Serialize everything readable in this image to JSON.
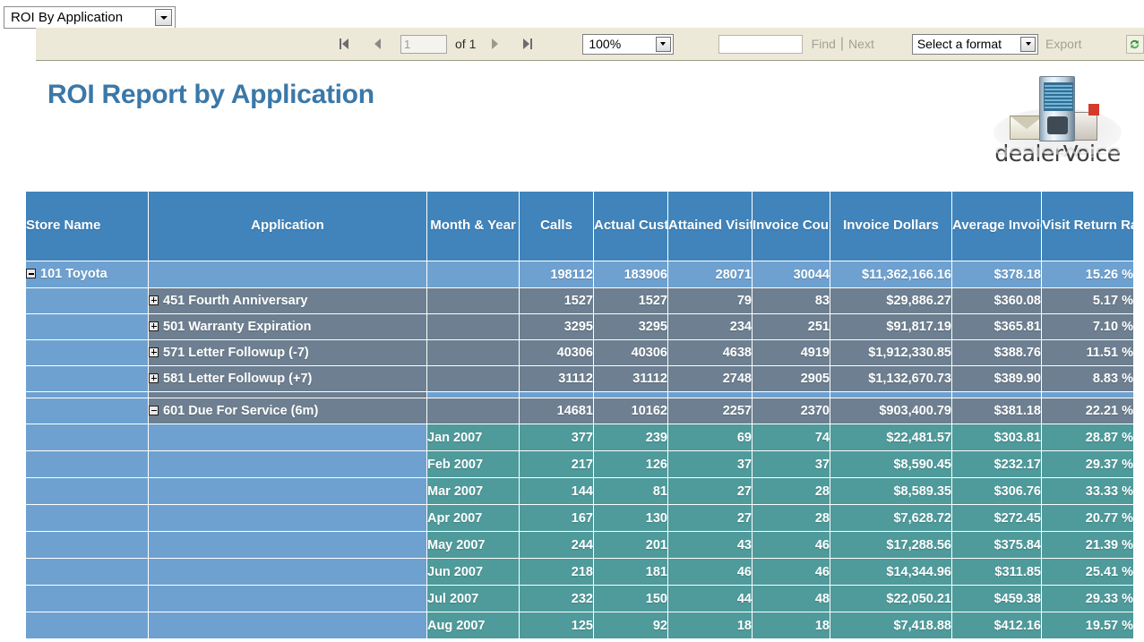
{
  "report_selector": {
    "value": "ROI By Application",
    "dropdown_icon": "chevron-down-icon"
  },
  "toolbar": {
    "first_page_icon": "first-page-icon",
    "prev_page_icon": "previous-page-icon",
    "next_page_icon": "next-page-icon",
    "last_page_icon": "last-page-icon",
    "page_number_value": "1",
    "page_of_label": "of 1",
    "zoom_value": "100%",
    "find_value": "",
    "find_label": "Find",
    "separator": "|",
    "next_label": "Next",
    "format_value": "Select a format",
    "export_label": "Export",
    "refresh_icon": "refresh-icon"
  },
  "report": {
    "title": "ROI Report by Application",
    "logo_text": "dealerVoice"
  },
  "table": {
    "columns": [
      "Store Name",
      "Application",
      "Month & Year",
      "Calls",
      "Actual Cust.",
      "Attained Visits",
      "Invoice Count",
      "Invoice Dollars",
      "Average Invoice $$$",
      "Visit Return Rate"
    ],
    "rows": [
      {
        "type": "store",
        "toggle": "minus",
        "store": "101 Toyota",
        "application": "",
        "month": "",
        "calls": "198112",
        "actual_cust": "183906",
        "attained_visits": "28071",
        "invoice_count": "30044",
        "invoice_dollars": "$11,362,166.16",
        "average_invoice": "$378.18",
        "visit_return_rate": "15.26 %"
      },
      {
        "type": "application",
        "toggle": "plus",
        "store": "",
        "application": "451 Fourth Anniversary",
        "month": "",
        "calls": "1527",
        "actual_cust": "1527",
        "attained_visits": "79",
        "invoice_count": "83",
        "invoice_dollars": "$29,886.27",
        "average_invoice": "$360.08",
        "visit_return_rate": "5.17 %"
      },
      {
        "type": "application",
        "toggle": "plus",
        "store": "",
        "application": "501 Warranty Expiration",
        "month": "",
        "calls": "3295",
        "actual_cust": "3295",
        "attained_visits": "234",
        "invoice_count": "251",
        "invoice_dollars": "$91,817.19",
        "average_invoice": "$365.81",
        "visit_return_rate": "7.10 %"
      },
      {
        "type": "application",
        "toggle": "plus",
        "store": "",
        "application": "571 Letter Followup (-7)",
        "month": "",
        "calls": "40306",
        "actual_cust": "40306",
        "attained_visits": "4638",
        "invoice_count": "4919",
        "invoice_dollars": "$1,912,330.85",
        "average_invoice": "$388.76",
        "visit_return_rate": "11.51 %"
      },
      {
        "type": "application",
        "toggle": "plus",
        "store": "",
        "application": "581 Letter Followup (+7)",
        "month": "",
        "calls": "31112",
        "actual_cust": "31112",
        "attained_visits": "2748",
        "invoice_count": "2905",
        "invoice_dollars": "$1,132,670.73",
        "average_invoice": "$389.90",
        "visit_return_rate": "8.83 %"
      },
      {
        "type": "spacer"
      },
      {
        "type": "application",
        "toggle": "minus",
        "store": "",
        "application": "601 Due For Service (6m)",
        "month": "",
        "calls": "14681",
        "actual_cust": "10162",
        "attained_visits": "2257",
        "invoice_count": "2370",
        "invoice_dollars": "$903,400.79",
        "average_invoice": "$381.18",
        "visit_return_rate": "22.21 %"
      },
      {
        "type": "month",
        "store": "",
        "application": "",
        "month": "Jan 2007",
        "calls": "377",
        "actual_cust": "239",
        "attained_visits": "69",
        "invoice_count": "74",
        "invoice_dollars": "$22,481.57",
        "average_invoice": "$303.81",
        "visit_return_rate": "28.87 %"
      },
      {
        "type": "month",
        "store": "",
        "application": "",
        "month": "Feb 2007",
        "calls": "217",
        "actual_cust": "126",
        "attained_visits": "37",
        "invoice_count": "37",
        "invoice_dollars": "$8,590.45",
        "average_invoice": "$232.17",
        "visit_return_rate": "29.37 %"
      },
      {
        "type": "month",
        "store": "",
        "application": "",
        "month": "Mar 2007",
        "calls": "144",
        "actual_cust": "81",
        "attained_visits": "27",
        "invoice_count": "28",
        "invoice_dollars": "$8,589.35",
        "average_invoice": "$306.76",
        "visit_return_rate": "33.33 %"
      },
      {
        "type": "month",
        "store": "",
        "application": "",
        "month": "Apr 2007",
        "calls": "167",
        "actual_cust": "130",
        "attained_visits": "27",
        "invoice_count": "28",
        "invoice_dollars": "$7,628.72",
        "average_invoice": "$272.45",
        "visit_return_rate": "20.77 %"
      },
      {
        "type": "month",
        "store": "",
        "application": "",
        "month": "May 2007",
        "calls": "244",
        "actual_cust": "201",
        "attained_visits": "43",
        "invoice_count": "46",
        "invoice_dollars": "$17,288.56",
        "average_invoice": "$375.84",
        "visit_return_rate": "21.39 %"
      },
      {
        "type": "month",
        "store": "",
        "application": "",
        "month": "Jun 2007",
        "calls": "218",
        "actual_cust": "181",
        "attained_visits": "46",
        "invoice_count": "46",
        "invoice_dollars": "$14,344.96",
        "average_invoice": "$311.85",
        "visit_return_rate": "25.41 %"
      },
      {
        "type": "month",
        "store": "",
        "application": "",
        "month": "Jul 2007",
        "calls": "232",
        "actual_cust": "150",
        "attained_visits": "44",
        "invoice_count": "48",
        "invoice_dollars": "$22,050.21",
        "average_invoice": "$459.38",
        "visit_return_rate": "29.33 %"
      },
      {
        "type": "month",
        "store": "",
        "application": "",
        "month": "Aug 2007",
        "calls": "125",
        "actual_cust": "92",
        "attained_visits": "18",
        "invoice_count": "18",
        "invoice_dollars": "$7,418.88",
        "average_invoice": "$412.16",
        "visit_return_rate": "19.57 %"
      }
    ]
  },
  "colors": {
    "header_blue": "#4084bb",
    "store_row_blue": "#6ea1d0",
    "application_row_gray": "#6d7f90",
    "month_row_teal": "#4f9a9b",
    "title_blue": "#3a78a8",
    "toolbar_beige": "#ece9d8"
  }
}
